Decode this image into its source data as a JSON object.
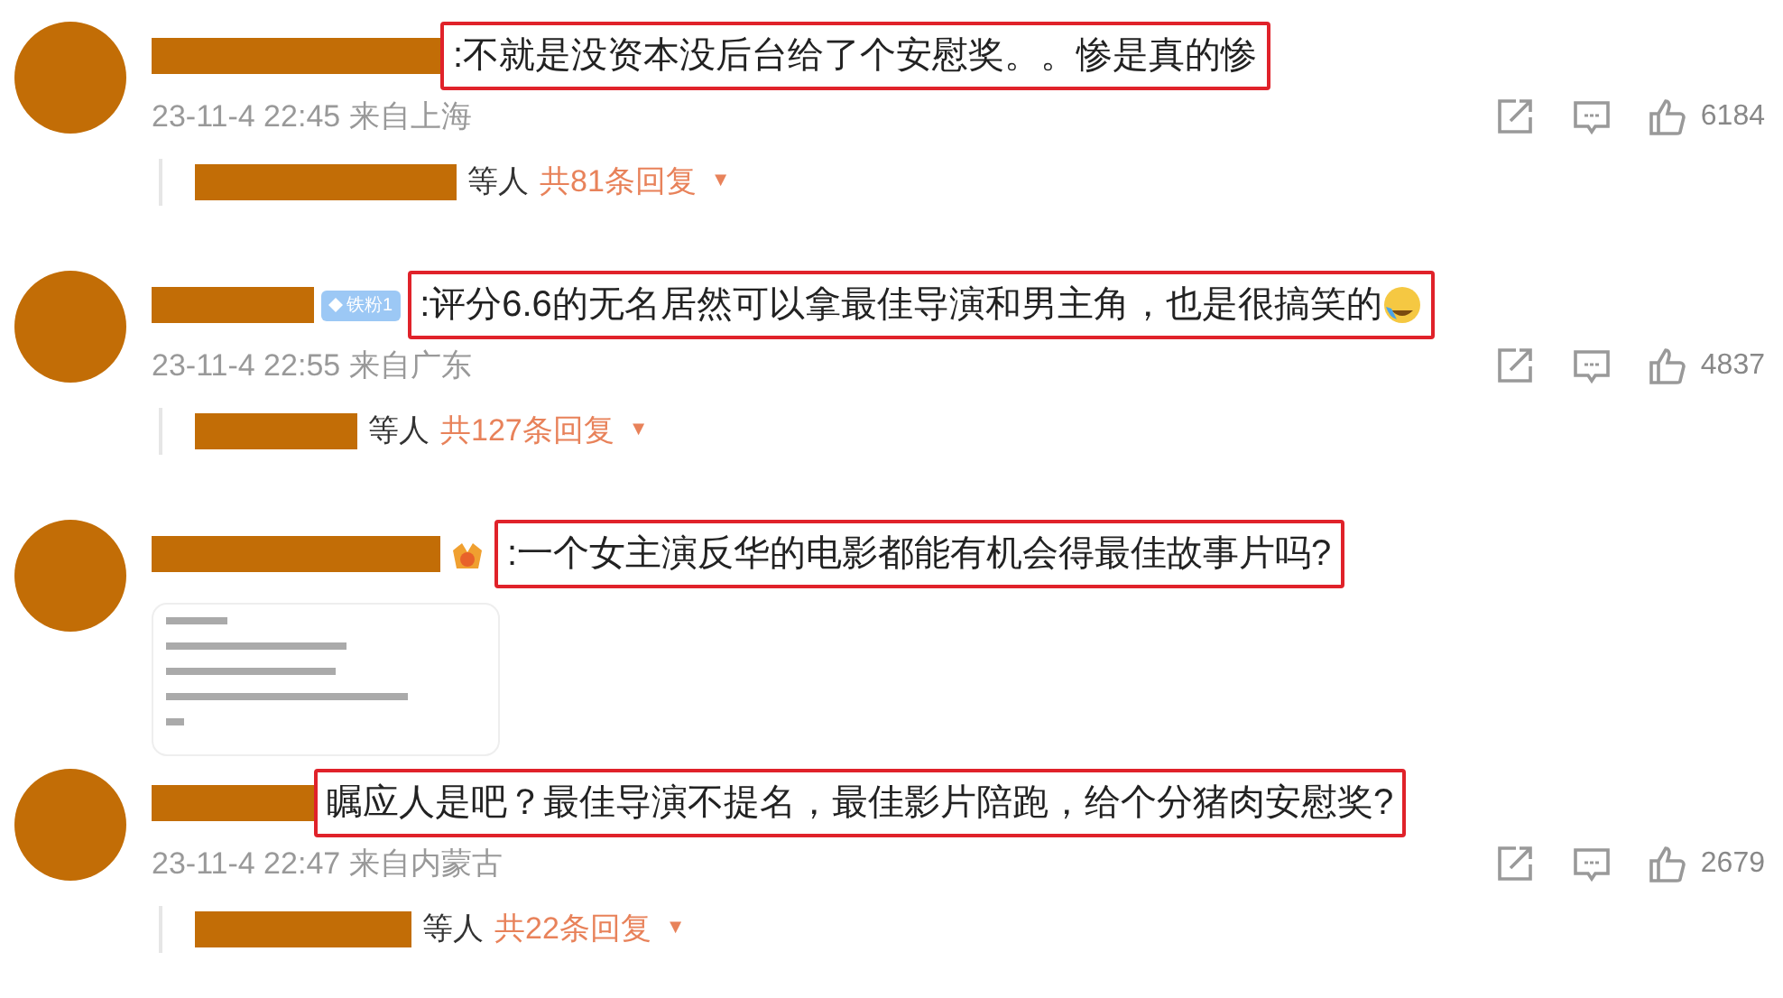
{
  "comments": [
    {
      "author_redacted": true,
      "text": ":不就是没资本没后台给了个安慰奖。。惨是真的惨",
      "highlighted": true,
      "meta": "23-11-4 22:45 来自上海",
      "likes": "6184",
      "replies": {
        "others": "等人",
        "count": "共81条回复",
        "caret": "▼"
      }
    },
    {
      "author_redacted": true,
      "badge": {
        "kind": "fan",
        "text": "铁粉1"
      },
      "text": ":评分6.6的无名居然可以拿最佳导演和男主角，也是很搞笑的",
      "trailing_emoji": true,
      "highlighted": true,
      "meta": "23-11-4 22:55 来自广东",
      "likes": "4837",
      "replies": {
        "others": "等人",
        "count": "共127条回复",
        "caret": "▼"
      }
    },
    {
      "author_redacted": true,
      "badge": {
        "kind": "medal"
      },
      "text": ":一个女主演反华的电影都能有机会得最佳故事片吗?",
      "highlighted": true
    },
    {
      "author_redacted": true,
      "text": "瞩应人是吧？最佳导演不提名，最佳影片陪跑，给个分猪肉安慰奖?",
      "highlighted": true,
      "meta": "23-11-4 22:47 来自内蒙古",
      "likes": "2679",
      "replies": {
        "others": "等人",
        "count": "共22条回复",
        "caret": "▼"
      }
    }
  ]
}
